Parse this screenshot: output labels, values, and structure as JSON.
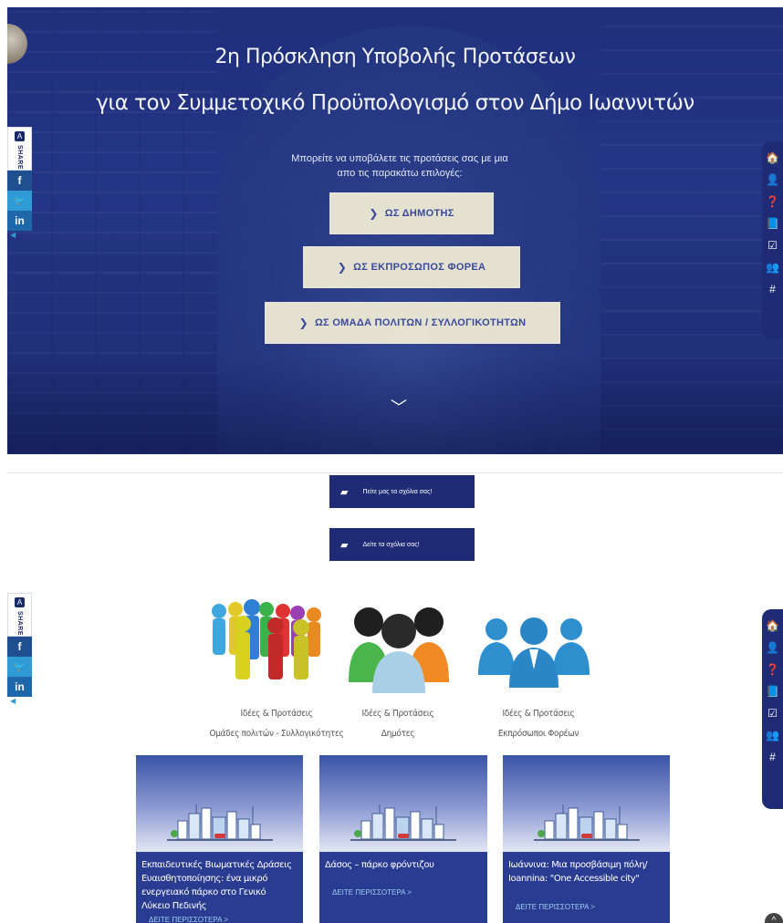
{
  "hero": {
    "title_line1": "2η Πρόσκληση Υποβολής Προτάσεων",
    "title_line2": "για τον Συμμετοχικό Προϋπολογισμό στον Δήμο Ιωαννιτών",
    "subtitle_line1": "Μπορείτε να υποβάλετε τις προτάσεις σας με μια",
    "subtitle_line2": "απο τις παρακάτω επιλογές:",
    "options": [
      {
        "label": "ΩΣ ΔΗΜΟΤΗΣ"
      },
      {
        "label": "ΩΣ ΕΚΠΡΟΣΩΠΟΣ ΦΟΡΕΑ"
      },
      {
        "label": "ΩΣ ΟΜΑΔΑ ΠΟΛΙΤΩΝ / ΣΥΛΛΟΓΙΚΟΤΗΤΩΝ"
      }
    ],
    "chevron": "❯",
    "scroll_down": "﹀"
  },
  "share": {
    "label": "SHARE",
    "facebook": "f",
    "twitter": "🐦",
    "linkedin": "in",
    "arrow": "◀"
  },
  "right_nav": {
    "items": [
      {
        "icon": "home-icon",
        "glyph": "🏠"
      },
      {
        "icon": "user-icon",
        "glyph": "👤"
      },
      {
        "icon": "help-icon",
        "glyph": "❓"
      },
      {
        "icon": "book-icon",
        "glyph": "📘"
      },
      {
        "icon": "checkbox-icon",
        "glyph": "☑"
      },
      {
        "icon": "group-icon",
        "glyph": "👥"
      },
      {
        "icon": "hashtag-icon",
        "glyph": "#"
      }
    ]
  },
  "comments": {
    "write_label": "Πείτε μας τα σχόλια σας!",
    "view_label": "Δείτε τα σχόλια σας!"
  },
  "categories": [
    {
      "line1": "Ιδέες & Προτάσεις",
      "line2": "Ομάδες πολιτών - Συλλογικότητες"
    },
    {
      "line1": "Ιδέες & Προτάσεις",
      "line2": "Δημότες"
    },
    {
      "line1": "Ιδέες & Προτάσεις",
      "line2": "Εκπρόσωποι Φορέων"
    }
  ],
  "cards": [
    {
      "title": "Εκπαιδευτικές Βιωματικές Δράσεις Ευαισθητοποίησης: ένα μικρό ενεργειακό πάρκο στο Γενικό Λύκειο Πεδινής",
      "more": "ΔΕΙΤΕ ΠΕΡΙΣΣΟΤΕΡΑ >"
    },
    {
      "title": "Δάσος – πάρκο φρόντιζου",
      "more": "ΔΕΙΤΕ ΠΕΡΙΣΣΟΤΕΡΑ >"
    },
    {
      "title": "Ιωάννινα: Μια προσβάσιμη πόλη/ Ioannina: \"One Accessible city\"",
      "more": "ΔΕΙΤΕ ΠΕΡΙΣΣΟΤΕΡΑ >"
    }
  ],
  "colors": {
    "navy": "#1f2c75",
    "hero_blue": "#243585",
    "card_blue": "#2a3b92",
    "button_cream": "#f3eed7"
  }
}
